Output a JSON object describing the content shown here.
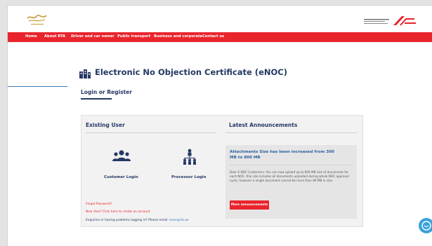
{
  "header": {
    "left_logo": "Government of Dubai logo",
    "right_logo": "RTA logo"
  },
  "nav": {
    "items": [
      "Home",
      "About RTA",
      "Driver and car owner",
      "Public transport",
      "Business and corporate",
      "Contact us"
    ]
  },
  "page": {
    "title": "Electronic No Objection Certificate (eNOC)",
    "tab": "Login or Register"
  },
  "existing_user": {
    "title": "Existing User",
    "customer_login": "Customer Login",
    "processor_login": "Processor Login",
    "forgot_password": "Forgot Password?",
    "new_user": "New User? Click here to create an account",
    "enquiry_text": "Enquiries or having problems logging in? Please email:",
    "enquiry_email": "enoc@rta.ae"
  },
  "announcements": {
    "title": "Latest Announcements",
    "headline": "Attachments Size has been increased from 300 MB to 800 MB",
    "body": "Dear E-NOC Customers: You can now upload up to 800 MB size of documents for each NOC, this size includes all documents uploaded during whole NOC approval cycle, however a single document cannot be more than 80 MB in size.",
    "button": "More announcements"
  },
  "colors": {
    "nav_red": "#e8242c",
    "navy": "#263864",
    "link_blue": "#2d5fa0",
    "chat_blue": "#3aa1db"
  }
}
